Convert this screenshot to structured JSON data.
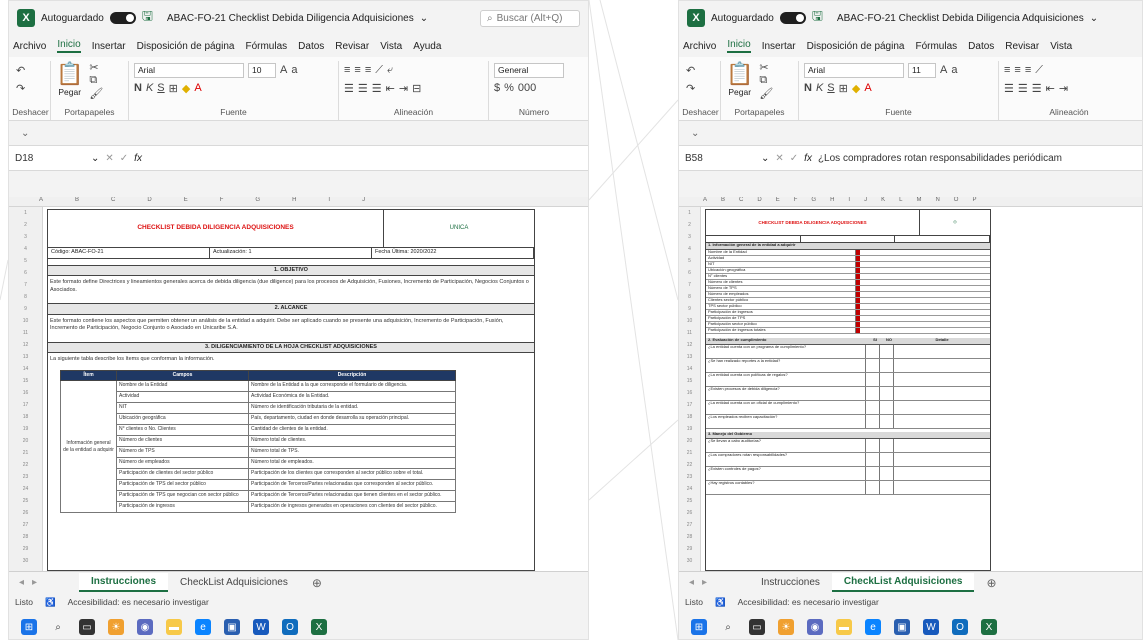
{
  "left": {
    "autosave_label": "Autoguardado",
    "doc_title": "ABAC-FO-21 Checklist Debida Diligencia Adquisiciones",
    "search_placeholder": "Buscar (Alt+Q)",
    "menu": [
      "Archivo",
      "Inicio",
      "Insertar",
      "Disposición de página",
      "Fórmulas",
      "Datos",
      "Revisar",
      "Vista",
      "Ayuda"
    ],
    "ribbon": {
      "undo_label": "Deshacer",
      "paste_label": "Pegar",
      "clipboard_label": "Portapapeles",
      "font_name": "Arial",
      "font_size": "10",
      "font_label": "Fuente",
      "align_label": "Alineación",
      "number_format": "General",
      "number_label": "Número"
    },
    "name_box": "D18",
    "formula": "",
    "sheet": {
      "title": "CHECKLIST DEBIDA DILIGENCIA ADQUISICIONES",
      "logo_text": "UNICA",
      "code": "Código: ABAC-FO-21",
      "version": "Actualización: 1",
      "date": "Fecha Última: 2020/2022",
      "sec1": "1. OBJETIVO",
      "sec1_text": "Este formato define Directrices y lineamientos generales acerca de debida diligencia (due diligence) para los procesos de Adquisición, Fusiones, Incremento de Participación, Negocios Conjuntos o Asociados.",
      "sec2": "2. ALCANCE",
      "sec2_text": "Este formato contiene los aspectos que permiten obtener un análisis de la entidad a adquirir. Debe ser aplicado cuando se presente una adquisición, Incremento de Participación, Fusión, Incremento de Participación, Negocio Conjunto o Asociado en Unicaribe S.A.",
      "sec3": "3. DILIGENCIAMIENTO DE LA HOJA CHECKLIST ADQUISICIONES",
      "sec3_text": "La siguiente tabla describe los ítems que conforman la información.",
      "table_headers": [
        "Ítem",
        "Campos",
        "Descripción"
      ],
      "group_label": "Información general de la entidad a adquirir",
      "rows": [
        [
          "Nombre de la Entidad",
          "Nombre de la Entidad a la que corresponde el formulario de diligencia."
        ],
        [
          "Actividad",
          "Actividad Económica de la Entidad."
        ],
        [
          "NIT",
          "Número de identificación tributaria de la entidad."
        ],
        [
          "Ubicación geográfica",
          "País, departamento, ciudad en donde desarrolla su operación principal."
        ],
        [
          "N° clientes o No. Clientes",
          "Cantidad de clientes de la entidad."
        ],
        [
          "Número de clientes",
          "Número total de clientes."
        ],
        [
          "Número de TPS",
          "Número total de TPS."
        ],
        [
          "Número de empleados",
          "Número total de empleados."
        ],
        [
          "Participación de clientes del sector público",
          "Participación de los clientes que corresponden al sector público sobre el total."
        ],
        [
          "Participación de TPS del sector público",
          "Participación de Terceros/Partes relacionadas que corresponden al sector público."
        ],
        [
          "Participación de TPS que negocian con sector público",
          "Participación de Terceros/Partes relacionadas que tienen clientes en el sector público."
        ],
        [
          "Participación de ingresos",
          "Participación de ingresos generados en operaciones con clientes del sector público."
        ]
      ]
    },
    "tabs": [
      "Instrucciones",
      "CheckList Adquisiciones"
    ],
    "active_tab": "Instrucciones",
    "status": [
      "Listo",
      "Accesibilidad: es necesario investigar"
    ]
  },
  "right": {
    "autosave_label": "Autoguardado",
    "doc_title": "ABAC-FO-21 Checklist Debida Diligencia Adquisiciones",
    "menu": [
      "Archivo",
      "Inicio",
      "Insertar",
      "Disposición de página",
      "Fórmulas",
      "Datos",
      "Revisar",
      "Vista"
    ],
    "ribbon": {
      "undo_label": "Deshacer",
      "paste_label": "Pegar",
      "clipboard_label": "Portapapeles",
      "font_name": "Arial",
      "font_size": "11",
      "font_label": "Fuente",
      "align_label": "Alineación"
    },
    "name_box": "B58",
    "formula": "¿Los compradores rotan responsabilidades periódicam",
    "sheet": {
      "title": "CHECKLIST DEBIDA DILIGENCIA ADQUISICIONES",
      "section_a": "1. Información general de la entidad a adquirir",
      "items": [
        "Nombre de la Entidad",
        "Actividad",
        "NIT",
        "Ubicación geográfica",
        "N° clientes",
        "Número de clientes",
        "Número de TPS",
        "Número de empleados",
        "Clientes sector público",
        "TPS sector público",
        "Participación de ingresos",
        "Participación de TPS",
        "Participación sector público",
        "Participación de ingresos totales"
      ],
      "section_b": "2. Evaluación de cumplimiento",
      "col_si": "SI",
      "col_no": "NO",
      "col_detalle": "Detalle",
      "questions": [
        "¿La entidad cuenta con un programa de cumplimiento?",
        "¿Se han realizado reportes a la entidad?",
        "¿La entidad cuenta con políticas de regalos?",
        "¿Existen procesos de debida diligencia?",
        "¿La entidad cuenta con un oficial de cumplimiento?",
        "¿Los empleados reciben capacitación?"
      ],
      "section_c": "3. Manejo del Gobierno",
      "questions_c": [
        "¿Se llevan a cabo auditorías?",
        "¿Los compradores rotan responsabilidades?",
        "¿Existen controles de pagos?",
        "¿Hay registros contables?"
      ]
    },
    "tabs": [
      "Instrucciones",
      "CheckList Adquisiciones"
    ],
    "active_tab": "CheckList Adquisiciones",
    "status": [
      "Listo",
      "Accesibilidad: es necesario investigar"
    ]
  }
}
